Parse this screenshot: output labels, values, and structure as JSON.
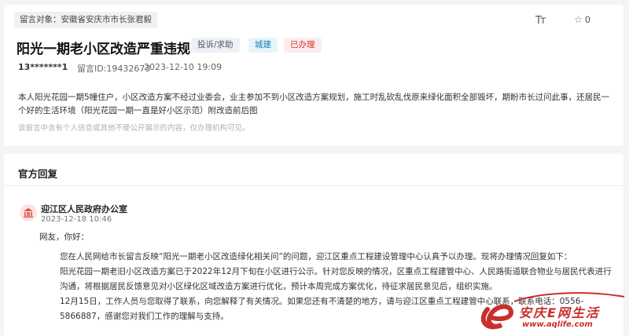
{
  "message": {
    "target_label": "留言对象：安徽省安庆市市长张君毅",
    "font_size_icon": "font-size-icon",
    "star_count": "0",
    "title": "阳光一期老小区改造严重违规",
    "badges": {
      "category": "投诉/求助",
      "domain": "城建",
      "status": "已办理"
    },
    "user": "13*******1",
    "id_text": "留言ID:19432673",
    "date": "2023-12-10 19:09",
    "content": "本人阳光花园一期5幢住户，小区改造方案不经过业委会，业主参加不到小区改造方案规划，施工时乱砍乱伐原来绿化面积全部毁坏，期盼市长过问此事，还居民一个好的生活环境（阳光花园一期一直是好小区示范）附改造前后图",
    "privacy_note": "该留言中含有个人信息或其他不便公开展示的内容，仅办理机构可见。"
  },
  "reply": {
    "heading": "官方回复",
    "org": "迎江区人民政府办公室",
    "date": "2023-12-18 10:46",
    "greeting": "网友，你好：",
    "p1": "您在人民网给市长留言反映“阳光一期老小区改造绿化相关问”的问题，迎江区重点工程建设管理中心认真予以办理。现将办理情况回复如下：",
    "p2": "阳光花园一期老旧小区改造方案已于2022年12月下旬在小区进行公示。针对您反映的情况，区重点工程建管中心、人民路街道联合物业与居民代表进行沟通，将根据居民反馈意见对小区绿化区域改造方案进行优化，预计本周完成方案优化，待征求居民意见后，组织实施。",
    "p3": "12月15日，工作人员与您取得了联系，向您解释了有关情况。如果您还有不清楚的地方，请与迎江区重点工程建管中心联系，联系电话：0556-5866887，感谢您对我们工作的理解与支持。"
  },
  "watermark": {
    "text": "安庆E网生活",
    "url": "www.aqlife.com"
  },
  "colors": {
    "status_red": "#d6312f",
    "domain_blue": "#1a7fb5",
    "watermark_red": "#c8302c"
  }
}
